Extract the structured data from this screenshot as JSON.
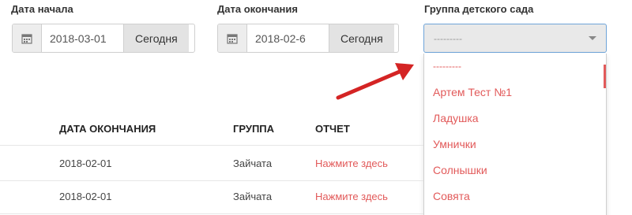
{
  "filters": {
    "start_date": {
      "label": "Дата начала",
      "value": "2018-03-01",
      "today_label": "Сегодня",
      "icon": "calendar-icon"
    },
    "end_date": {
      "label": "Дата окончания",
      "value": "2018-02-6",
      "today_label": "Сегодня",
      "icon": "calendar-icon"
    },
    "group": {
      "label": "Группа детского сада",
      "selected": "---------",
      "icon": "chevron-down-icon",
      "options": [
        "---------",
        "Артем Тест №1",
        "Ладушка",
        "Умнички",
        "Солнышки",
        "Совята"
      ]
    }
  },
  "table": {
    "headers": {
      "end_date": "ДАТА ОКОНЧАНИЯ",
      "group": "ГРУППА",
      "report": "ОТЧЕТ"
    },
    "rows": [
      {
        "end_date": "2018-02-01",
        "group": "Зайчата",
        "report": "Нажмите здесь"
      },
      {
        "end_date": "2018-02-01",
        "group": "Зайчата",
        "report": "Нажмите здесь"
      }
    ]
  },
  "colors": {
    "accent_link": "#e25a5a",
    "select_border": "#6ea4d9",
    "arrow": "#d42424"
  }
}
